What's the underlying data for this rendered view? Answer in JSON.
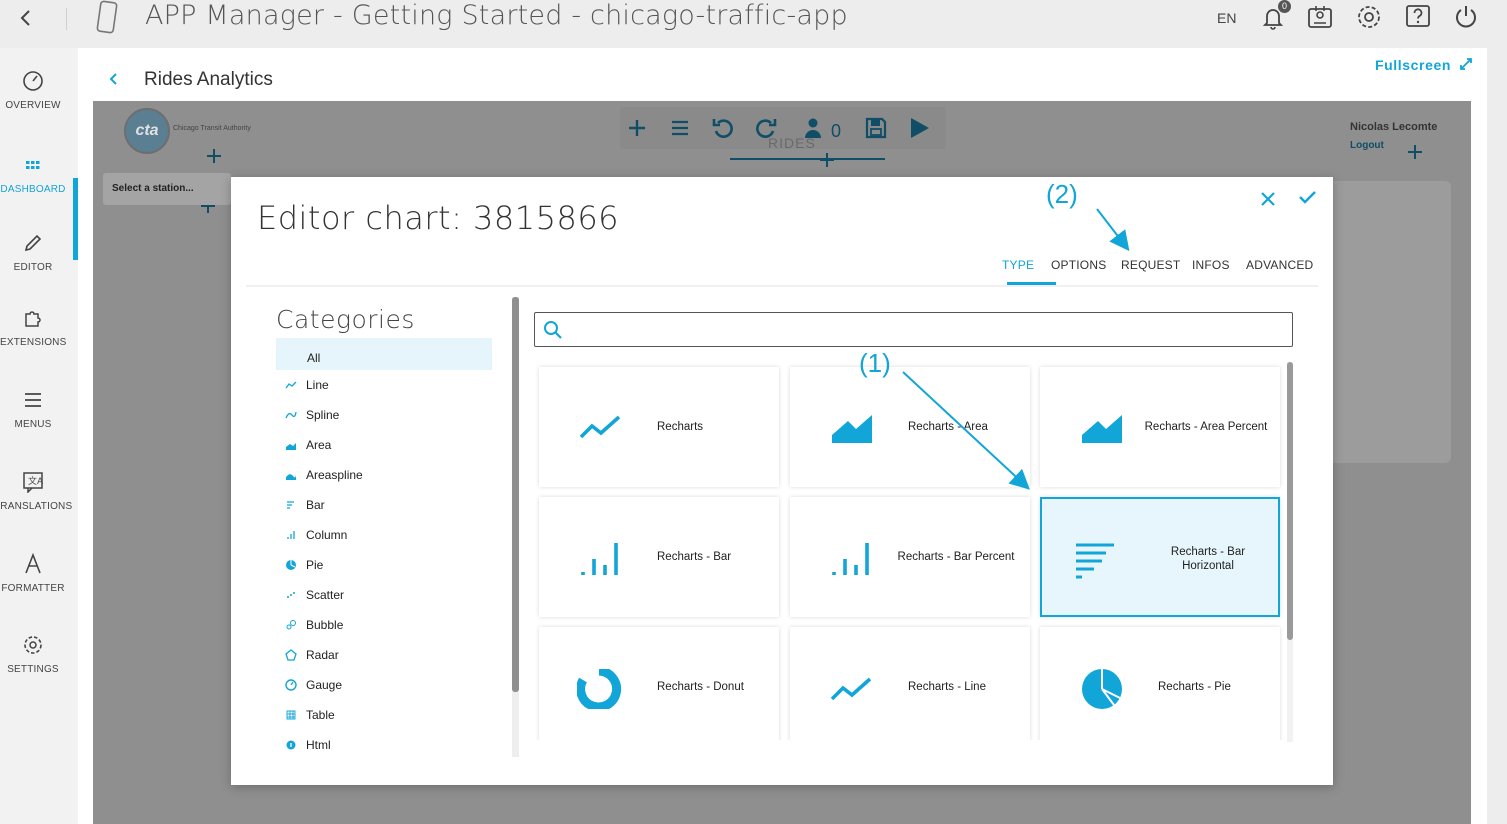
{
  "topbar": {
    "title": "APP Manager - Getting Started - chicago-traffic-app",
    "language": "EN",
    "notification_count": "0",
    "icons": [
      "back-icon",
      "phone-icon",
      "bell-icon",
      "contact-card-icon",
      "gear-icon",
      "help-icon",
      "power-icon"
    ]
  },
  "sidebar": {
    "items": [
      {
        "label": "OVERVIEW",
        "icon": "speedometer-icon"
      },
      {
        "label": "DASHBOARD",
        "icon": "grid-icon",
        "active": true
      },
      {
        "label": "EDITOR",
        "icon": "pencil-icon"
      },
      {
        "label": "EXTENSIONS",
        "icon": "puzzle-icon"
      },
      {
        "label": "MENUS",
        "icon": "menu-icon"
      },
      {
        "label": "TRANSLATIONS",
        "icon": "translate-icon"
      },
      {
        "label": "FORMATTER",
        "icon": "formatter-icon"
      },
      {
        "label": "SETTINGS",
        "icon": "gear-icon"
      }
    ]
  },
  "page": {
    "title": "Rides Analytics",
    "fullscreen_label": "Fullscreen"
  },
  "dashboard": {
    "logo_text": "cta",
    "logo_subtitle": "Chicago Transit Authority",
    "user_count": "0",
    "rides_label": "RIDES",
    "user_name": "Nicolas Lecomte",
    "logout_label": "Logout",
    "station_placeholder": "Select a station..."
  },
  "modal": {
    "title": "Editor chart: 3815866",
    "tabs": [
      "TYPE",
      "OPTIONS",
      "REQUEST",
      "INFOS",
      "ADVANCED"
    ],
    "active_tab": "TYPE",
    "categories_title": "Categories",
    "categories": [
      {
        "label": "All"
      },
      {
        "label": "Line",
        "icon": "line-chart-icon"
      },
      {
        "label": "Spline",
        "icon": "spline-chart-icon"
      },
      {
        "label": "Area",
        "icon": "area-chart-icon"
      },
      {
        "label": "Areaspline",
        "icon": "areaspline-chart-icon"
      },
      {
        "label": "Bar",
        "icon": "bar-chart-icon"
      },
      {
        "label": "Column",
        "icon": "column-chart-icon"
      },
      {
        "label": "Pie",
        "icon": "pie-chart-icon"
      },
      {
        "label": "Scatter",
        "icon": "scatter-chart-icon"
      },
      {
        "label": "Bubble",
        "icon": "bubble-chart-icon"
      },
      {
        "label": "Radar",
        "icon": "radar-chart-icon"
      },
      {
        "label": "Gauge",
        "icon": "gauge-icon"
      },
      {
        "label": "Table",
        "icon": "table-icon"
      },
      {
        "label": "Html",
        "icon": "html-icon"
      }
    ],
    "search_placeholder": "",
    "chart_types": [
      {
        "label": "Recharts",
        "icon": "line-chart-icon"
      },
      {
        "label": "Recharts - Area",
        "icon": "area-chart-icon"
      },
      {
        "label": "Recharts - Area Percent",
        "icon": "area-chart-icon"
      },
      {
        "label": "Recharts - Bar",
        "icon": "column-chart-icon"
      },
      {
        "label": "Recharts - Bar Percent",
        "icon": "column-chart-icon"
      },
      {
        "label": "Recharts - Bar Horizontal",
        "icon": "bar-chart-icon",
        "selected": true
      },
      {
        "label": "Recharts - Donut",
        "icon": "donut-chart-icon"
      },
      {
        "label": "Recharts - Line",
        "icon": "line-chart-icon"
      },
      {
        "label": "Recharts - Pie",
        "icon": "pie-chart-icon"
      }
    ]
  },
  "annotations": {
    "step1": "(1)",
    "step2": "(2)"
  },
  "colors": {
    "accent": "#12a5d8",
    "accent_light": "#e6f6fc",
    "dashboard_overlay": "#8f8f8f",
    "dark_accent": "#0f4e66"
  }
}
